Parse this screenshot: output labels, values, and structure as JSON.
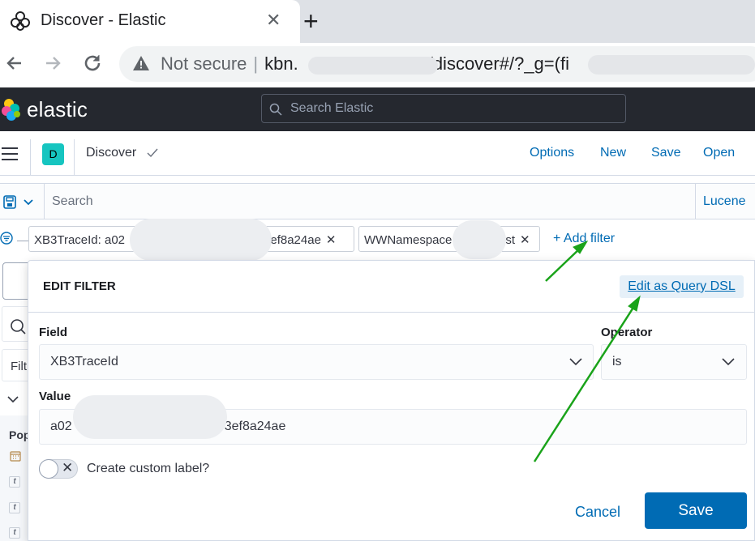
{
  "browser": {
    "tab_title": "Discover - Elastic",
    "tab_close": "✕",
    "new_tab": "+",
    "security_label": "Not secure",
    "url_prefix": "kbn.",
    "url_path": "/discover#/?_g=(fi"
  },
  "kibana": {
    "brand": "elastic",
    "search_placeholder": "Search Elastic",
    "avatar_letter": "D",
    "app_name": "Discover",
    "nav": [
      "Options",
      "New",
      "Save",
      "Open"
    ]
  },
  "query": {
    "placeholder": "Search",
    "language": "Lucene"
  },
  "filters": [
    {
      "prefix": "XB3TraceId: a02",
      "suffix": "3ef8a24ae"
    },
    {
      "prefix": "WWNamespace",
      "suffix": "st"
    }
  ],
  "add_filter": "+ Add filter",
  "sidebar": {
    "filter_text": "Filt",
    "popular_text": "Pop",
    "type_glyph": "t"
  },
  "edit_filter": {
    "title": "EDIT FILTER",
    "edit_dsl": "Edit as Query DSL",
    "field_label": "Field",
    "field_value": "XB3TraceId",
    "operator_label": "Operator",
    "operator_value": "is",
    "value_label": "Value",
    "value_prefix": "a02",
    "value_suffix": "3ef8a24ae",
    "custom_label": "Create custom label?",
    "cancel": "Cancel",
    "save": "Save"
  },
  "colors": {
    "accent": "#006bb4",
    "header_bg": "#25282f",
    "annotation_arrow": "#1aa31a"
  },
  "icons": [
    "elastic-logo-icon",
    "hamburger-menu-icon",
    "check-icon",
    "save-query-icon",
    "chevron-down-icon",
    "filter-menu-icon",
    "search-icon",
    "calendar-icon",
    "close-icon",
    "back-icon",
    "forward-icon",
    "reload-icon",
    "warning-icon"
  ]
}
